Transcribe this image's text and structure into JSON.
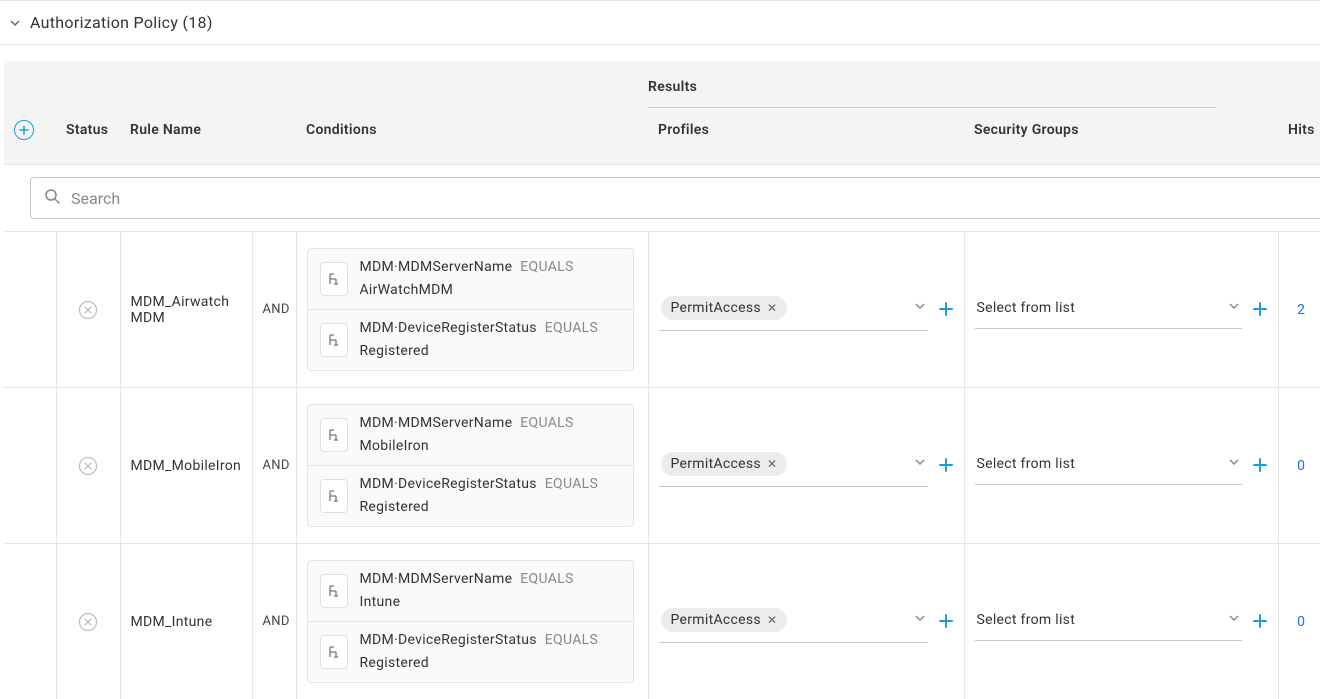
{
  "section": {
    "title": "Authorization Policy (18)"
  },
  "headers": {
    "results_group": "Results",
    "status": "Status",
    "rule_name": "Rule Name",
    "conditions": "Conditions",
    "profiles": "Profiles",
    "security_groups": "Security Groups",
    "hits": "Hits"
  },
  "search": {
    "placeholder": "Search"
  },
  "select_placeholder": "Select from list",
  "rows": [
    {
      "name": "MDM_Airwatch MDM",
      "join": "AND",
      "conditions": [
        {
          "attr": "MDM·MDMServerName",
          "op": "EQUALS",
          "val": "AirWatchMDM"
        },
        {
          "attr": "MDM·DeviceRegisterStatus",
          "op": "EQUALS",
          "val": "Registered"
        }
      ],
      "profile_chip": "PermitAccess",
      "hits": "2"
    },
    {
      "name": "MDM_MobileIron",
      "join": "AND",
      "conditions": [
        {
          "attr": "MDM·MDMServerName",
          "op": "EQUALS",
          "val": "MobileIron"
        },
        {
          "attr": "MDM·DeviceRegisterStatus",
          "op": "EQUALS",
          "val": "Registered"
        }
      ],
      "profile_chip": "PermitAccess",
      "hits": "0"
    },
    {
      "name": "MDM_Intune",
      "join": "AND",
      "conditions": [
        {
          "attr": "MDM·MDMServerName",
          "op": "EQUALS",
          "val": "Intune"
        },
        {
          "attr": "MDM·DeviceRegisterStatus",
          "op": "EQUALS",
          "val": "Registered"
        }
      ],
      "profile_chip": "PermitAccess",
      "hits": "0"
    }
  ]
}
